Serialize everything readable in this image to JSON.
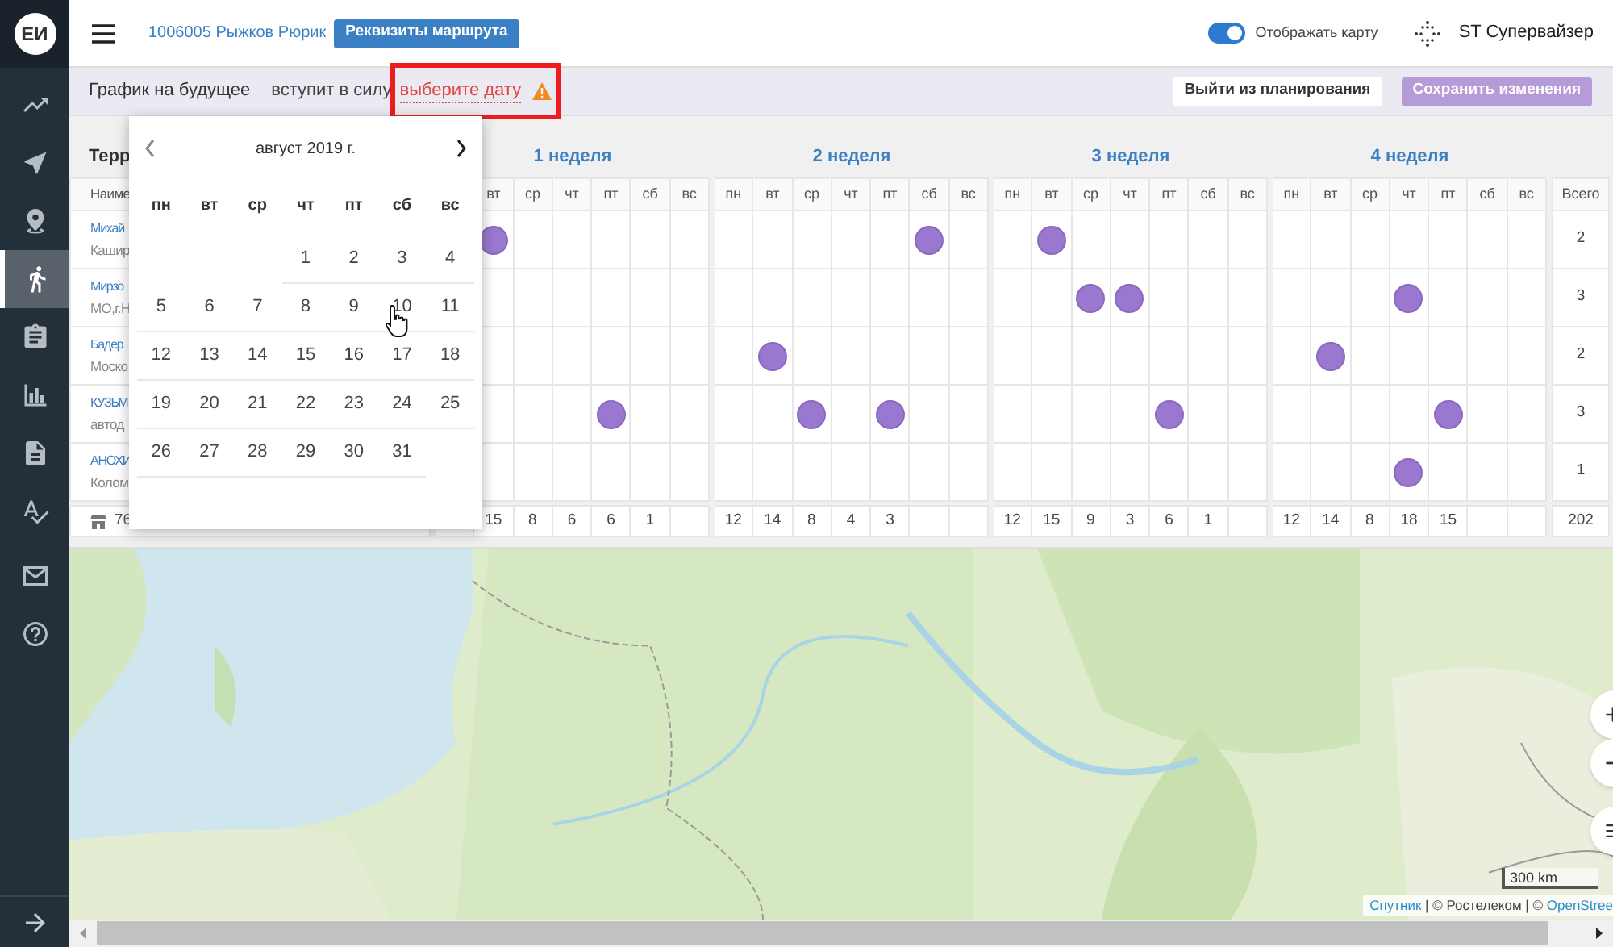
{
  "sidebar": {
    "avatar": "ЕИ",
    "nav": [
      {
        "selected": false
      },
      {
        "selected": false
      },
      {
        "selected": false
      },
      {
        "selected": true
      },
      {
        "selected": false
      },
      {
        "selected": false
      },
      {
        "selected": false
      },
      {
        "selected": false
      }
    ]
  },
  "header": {
    "route_link": "1006005 Рыжков Рюрик",
    "route_button": "Реквизиты маршрута",
    "map_toggle": {
      "label": "Отображать карту",
      "on": true
    },
    "user": "ST Супервайзер"
  },
  "planning_bar": {
    "title": "График на будущее",
    "effective_label": "вступит в силу",
    "date_link": "выберите дату",
    "warning": true,
    "highlighted": true,
    "exit_button": "Выйти из планирования",
    "save_button": {
      "label": "Сохранить изменения",
      "disabled": true
    }
  },
  "table": {
    "left_title": "Терр",
    "left_header": "Наиме",
    "left_footer": "76",
    "weeks": [
      {
        "title": "1 неделя",
        "days": [
          "вт",
          "ср",
          "чт",
          "пт",
          "сб",
          "вс"
        ],
        "totals": [
          "15",
          "8",
          "6",
          "6",
          "1"
        ]
      },
      {
        "title": "2 неделя",
        "days": [
          "пн",
          "вт",
          "ср",
          "чт",
          "пт",
          "сб",
          "вс"
        ],
        "totals": [
          "12",
          "14",
          "8",
          "4",
          "3"
        ]
      },
      {
        "title": "3 неделя",
        "days": [
          "пн",
          "вт",
          "ср",
          "чт",
          "пт",
          "сб",
          "вс"
        ],
        "totals": [
          "12",
          "15",
          "9",
          "3",
          "6",
          "1"
        ]
      },
      {
        "title": "4 неделя",
        "days": [
          "пн",
          "вт",
          "ср",
          "чт",
          "пт",
          "сб",
          "вс"
        ],
        "totals": [
          "12",
          "14",
          "8",
          "18",
          "15"
        ]
      }
    ],
    "total_header": "Всего",
    "grand_total": "202",
    "rows": [
      {
        "name": "Михай",
        "address": "Кашир",
        "total": "2",
        "visits": [
          [
            true,
            false,
            false,
            false,
            false,
            false
          ],
          [
            false,
            false,
            false,
            false,
            false,
            true,
            false
          ],
          [
            false,
            true,
            false,
            false,
            false,
            false,
            false
          ],
          [
            false,
            false,
            false,
            false,
            false,
            false,
            false
          ]
        ]
      },
      {
        "name": "Мирзо",
        "address": "МО,г.Н",
        "total": "3",
        "visits": [
          [
            false,
            false,
            false,
            false,
            false,
            false
          ],
          [
            false,
            false,
            false,
            false,
            false,
            false,
            false
          ],
          [
            false,
            false,
            true,
            true,
            false,
            false,
            false
          ],
          [
            false,
            false,
            false,
            true,
            false,
            false,
            false
          ]
        ]
      },
      {
        "name": "Бадер",
        "address": "Моско",
        "total": "2",
        "visits": [
          [
            false,
            false,
            false,
            false,
            false,
            false
          ],
          [
            false,
            true,
            false,
            false,
            false,
            false,
            false
          ],
          [
            false,
            false,
            false,
            false,
            false,
            false,
            false
          ],
          [
            false,
            true,
            false,
            false,
            false,
            false,
            false
          ]
        ]
      },
      {
        "name": "КУЗЬМ",
        "address": "автод",
        "total": "3",
        "visits": [
          [
            false,
            false,
            false,
            true,
            false,
            false
          ],
          [
            false,
            false,
            true,
            false,
            true,
            false,
            false
          ],
          [
            false,
            false,
            false,
            false,
            true,
            false,
            false
          ],
          [
            false,
            false,
            false,
            false,
            true,
            false,
            false
          ]
        ]
      },
      {
        "name": "АНОХИ",
        "address": "Колом",
        "total": "1",
        "visits": [
          [
            false,
            false,
            false,
            false,
            false,
            false
          ],
          [
            false,
            false,
            false,
            false,
            false,
            false,
            false
          ],
          [
            false,
            false,
            false,
            false,
            false,
            false,
            false
          ],
          [
            false,
            false,
            false,
            true,
            false,
            false,
            false
          ]
        ]
      }
    ]
  },
  "calendar": {
    "month": "август 2019 г.",
    "weekdays": [
      "пн",
      "вт",
      "ср",
      "чт",
      "пт",
      "сб",
      "вс"
    ],
    "weeks": [
      [
        "1",
        "2",
        "3",
        "4"
      ],
      [
        "5",
        "6",
        "7",
        "8",
        "9",
        "10",
        "11"
      ],
      [
        "12",
        "13",
        "14",
        "15",
        "16",
        "17",
        "18"
      ],
      [
        "19",
        "20",
        "21",
        "22",
        "23",
        "24",
        "25"
      ],
      [
        "26",
        "27",
        "28",
        "29",
        "30",
        "31"
      ]
    ]
  },
  "map": {
    "kind": "picture",
    "scale": "300 km",
    "attribution": [
      {
        "text": "Спутник",
        "link": true
      },
      {
        "text": " | © Ростелеком | © ",
        "link": false
      },
      {
        "text": "OpenStree",
        "link": true
      }
    ]
  }
}
